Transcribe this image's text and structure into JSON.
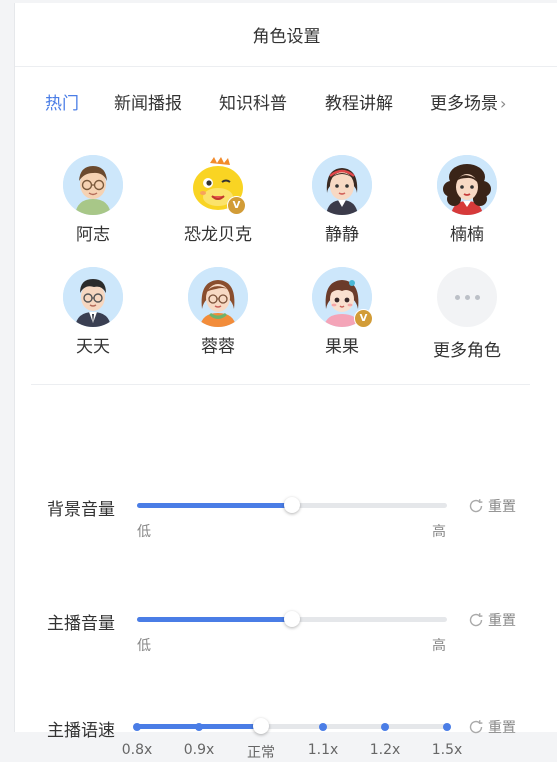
{
  "header": {
    "title": "角色设置"
  },
  "tabs": [
    {
      "label": "热门",
      "active": true
    },
    {
      "label": "新闻播报"
    },
    {
      "label": "知识科普"
    },
    {
      "label": "教程讲解"
    },
    {
      "label": "更多场景",
      "chevron": "›"
    }
  ],
  "roles": [
    {
      "name": "阿志",
      "icon": "man-glasses-avatar-icon"
    },
    {
      "name": "恐龙贝克",
      "icon": "yellow-dinosaur-avatar-icon",
      "vip": true
    },
    {
      "name": "静静",
      "icon": "girl-headband-avatar-icon"
    },
    {
      "name": "楠楠",
      "icon": "woman-curly-hair-avatar-icon"
    },
    {
      "name": "天天",
      "icon": "man-suit-glasses-avatar-icon"
    },
    {
      "name": "蓉蓉",
      "icon": "woman-glasses-avatar-icon"
    },
    {
      "name": "果果",
      "icon": "little-girl-avatar-icon",
      "vip": true
    },
    {
      "name": "更多角色",
      "icon": "more-dots-icon"
    }
  ],
  "vip_badge": "V",
  "sliders": {
    "bg_volume": {
      "label": "背景音量",
      "low": "低",
      "high": "高",
      "value": 0.5,
      "reset": "重置"
    },
    "host_volume": {
      "label": "主播音量",
      "low": "低",
      "high": "高",
      "value": 0.5,
      "reset": "重置"
    },
    "host_speed": {
      "label": "主播语速",
      "options": [
        "0.8x",
        "0.9x",
        "正常",
        "1.1x",
        "1.2x",
        "1.5x"
      ],
      "selected": "正常",
      "reset": "重置"
    }
  },
  "colors": {
    "accent": "#4a7de6",
    "vip": "#d29c37"
  }
}
